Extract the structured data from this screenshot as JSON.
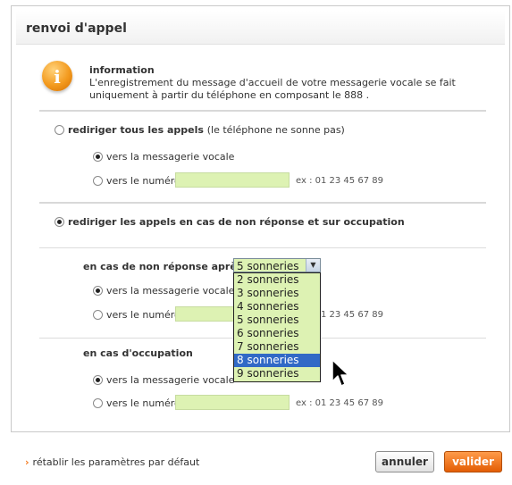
{
  "panel": {
    "title": "renvoi d'appel"
  },
  "info": {
    "title": "information",
    "text": "L'enregistrement du message d'accueil de votre messagerie vocale se fait uniquement à partir du téléphone en composant le 888 .",
    "icon": "info-icon",
    "icon_glyph": "i"
  },
  "section_all": {
    "label": "rediriger tous les appels",
    "note": "(le téléphone ne sonne pas)",
    "selected": false,
    "opt_voicemail": "vers la messagerie vocale",
    "opt_number": "vers le numéro",
    "number_value": "",
    "example": "ex : 01 23 45 67 89"
  },
  "section_conditional": {
    "label": "rediriger les appels en cas de non réponse et sur occupation",
    "selected": true,
    "no_answer": {
      "label": "en cas de non réponse après",
      "select_value": "5 sonneries",
      "options": [
        "2 sonneries",
        "3 sonneries",
        "4 sonneries",
        "5 sonneries",
        "6 sonneries",
        "7 sonneries",
        "8 sonneries",
        "9 sonneries"
      ],
      "highlighted": "8 sonneries",
      "opt_voicemail": "vers la messagerie vocale",
      "opt_number": "vers le numéro",
      "example": "ex : 01 23 45 67 89"
    },
    "busy": {
      "label": "en cas d'occupation",
      "opt_voicemail": "vers la messagerie vocale",
      "opt_number": "vers le numéro",
      "example": "ex : 01 23 45 67 89"
    }
  },
  "footer": {
    "reset_label": "rétablir les paramètres par défaut",
    "cancel_label": "annuler",
    "submit_label": "valider"
  },
  "colors": {
    "accent": "#f47b20",
    "field_bg": "#ddf2b3",
    "highlight": "#3169c6"
  }
}
